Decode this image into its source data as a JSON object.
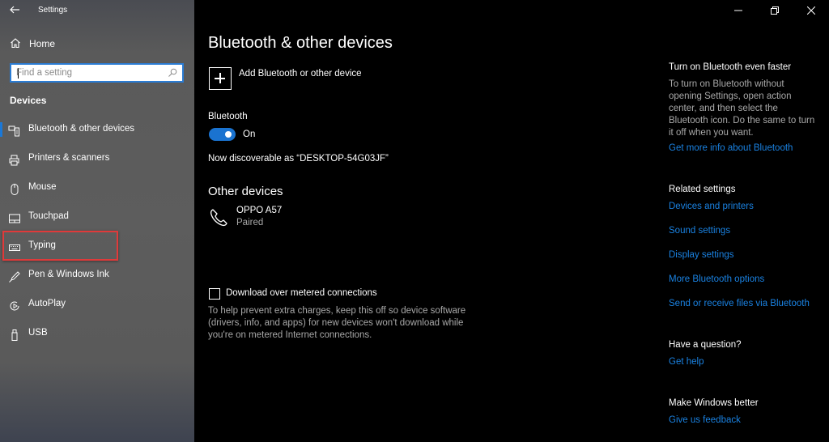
{
  "window": {
    "title": "Settings",
    "controls": [
      "minimize",
      "restore",
      "close"
    ]
  },
  "sidebar": {
    "home_label": "Home",
    "search": {
      "placeholder": "Find a setting",
      "value": ""
    },
    "section_heading": "Devices",
    "items": [
      {
        "label": "Bluetooth & other devices",
        "icon": "bluetooth-devices-icon",
        "active": true
      },
      {
        "label": "Printers & scanners",
        "icon": "printer-icon",
        "active": false
      },
      {
        "label": "Mouse",
        "icon": "mouse-icon",
        "active": false
      },
      {
        "label": "Touchpad",
        "icon": "touchpad-icon",
        "active": false
      },
      {
        "label": "Typing",
        "icon": "keyboard-icon",
        "active": false,
        "highlighted": true
      },
      {
        "label": "Pen & Windows Ink",
        "icon": "pen-icon",
        "active": false
      },
      {
        "label": "AutoPlay",
        "icon": "autoplay-icon",
        "active": false
      },
      {
        "label": "USB",
        "icon": "usb-icon",
        "active": false
      }
    ],
    "highlight_color": "#e03a3a",
    "accent_color": "#1a78d8"
  },
  "main": {
    "title": "Bluetooth & other devices",
    "add_device_label": "Add Bluetooth or other device",
    "bluetooth": {
      "label": "Bluetooth",
      "state": "On",
      "enabled": true,
      "discoverable_text": "Now discoverable as “DESKTOP-54G03JF”"
    },
    "other_devices": {
      "heading": "Other devices",
      "devices": [
        {
          "name": "OPPO A57",
          "status": "Paired",
          "icon": "phone-icon"
        }
      ]
    },
    "metered": {
      "label": "Download over metered connections",
      "checked": false,
      "description": "To help prevent extra charges, keep this off so device software (drivers, info, and apps) for new devices won't download while you're on metered Internet connections."
    }
  },
  "aside": {
    "tip": {
      "heading": "Turn on Bluetooth even faster",
      "body": "To turn on Bluetooth without opening Settings, open action center, and then select the Bluetooth icon. Do the same to turn it off when you want.",
      "link": "Get more info about Bluetooth"
    },
    "related": {
      "heading": "Related settings",
      "links": [
        "Devices and printers",
        "Sound settings",
        "Display settings",
        "More Bluetooth options",
        "Send or receive files via Bluetooth"
      ]
    },
    "question": {
      "heading": "Have a question?",
      "link": "Get help"
    },
    "feedback": {
      "heading": "Make Windows better",
      "link": "Give us feedback"
    },
    "link_color": "#1a82e2"
  }
}
